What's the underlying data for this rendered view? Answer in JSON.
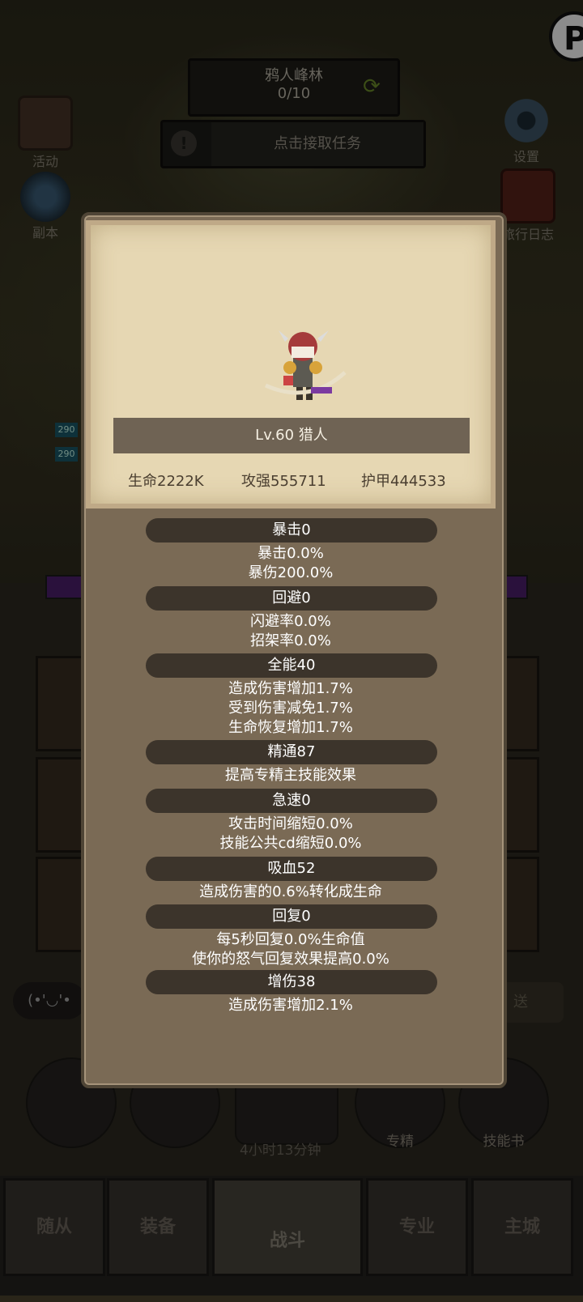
{
  "header": {
    "zone_name": "鸦人峰林",
    "zone_progress": "0/10",
    "task_button": "点击接取任务"
  },
  "side_buttons": {
    "activity": "活动",
    "dungeon": "副本",
    "settings": "设置",
    "journal": "旅行日志"
  },
  "hp_tags": [
    "290",
    "290"
  ],
  "character": {
    "title": "Lv.60 猎人",
    "hp": "生命2222K",
    "attack": "攻强555711",
    "armor": "护甲444533"
  },
  "stats": [
    {
      "name": "暴击0",
      "lines": [
        "暴击0.0%",
        "暴伤200.0%"
      ]
    },
    {
      "name": "回避0",
      "lines": [
        "闪避率0.0%",
        "招架率0.0%"
      ]
    },
    {
      "name": "全能40",
      "lines": [
        "造成伤害增加1.7%",
        "受到伤害减免1.7%",
        "生命恢复增加1.7%"
      ]
    },
    {
      "name": "精通87",
      "lines": [
        "提高专精主技能效果"
      ]
    },
    {
      "name": "急速0",
      "lines": [
        "攻击时间缩短0.0%",
        "技能公共cd缩短0.0%"
      ]
    },
    {
      "name": "吸血52",
      "lines": [
        "造成伤害的0.6%转化成生命"
      ]
    },
    {
      "name": "回复0",
      "lines": [
        "每5秒回复0.0%生命值",
        "使你的怒气回复效果提高0.0%"
      ]
    },
    {
      "name": "增伤38",
      "lines": [
        "造成伤害增加2.1%"
      ]
    }
  ],
  "chat": {
    "emoticon": "(•'◡'•",
    "send": "送"
  },
  "bottom_circles": {
    "spec": "专精",
    "skill_book": "技能书"
  },
  "timer": "4小时13分钟",
  "nav": {
    "followers": "随从",
    "equipment": "装备",
    "battle": "战斗",
    "profession": "专业",
    "main_city": "主城"
  },
  "colors": {
    "panel": "#7a6a55",
    "parchment": "#e6d7b3",
    "stat_header": "#3c342b"
  }
}
